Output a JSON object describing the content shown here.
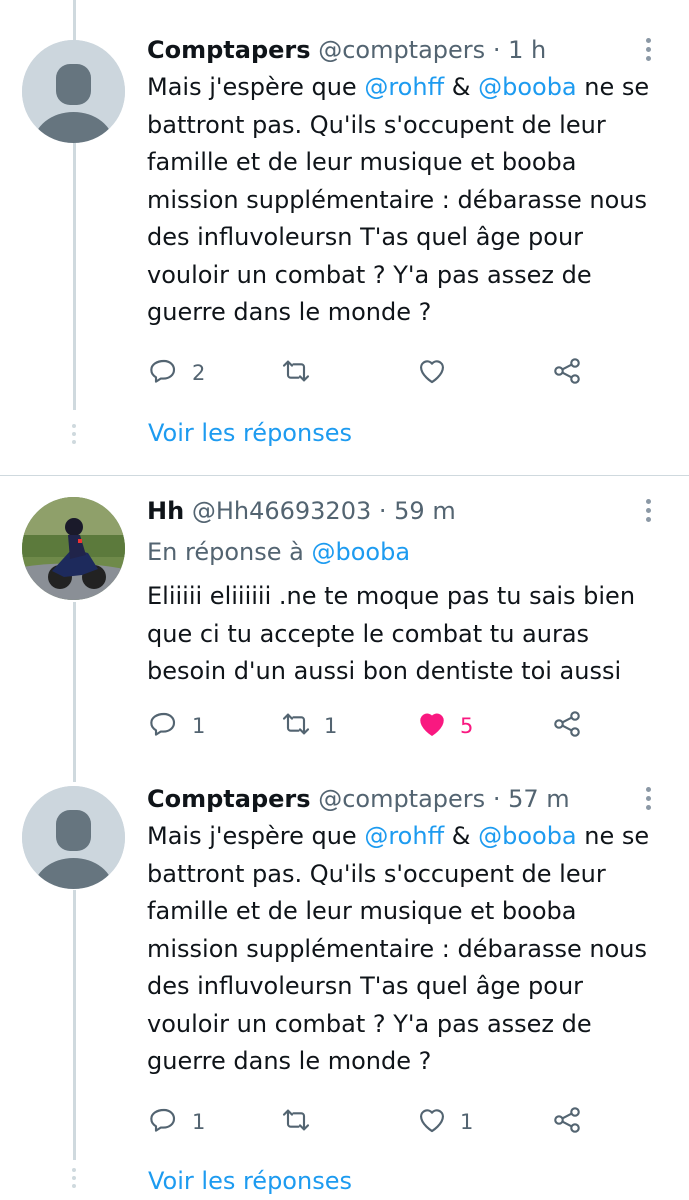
{
  "tweets": [
    {
      "author_name": "Comptapers",
      "handle": "@comptapers",
      "sep": "·",
      "time": "1 h",
      "body": [
        {
          "t": "Mais j'espère que "
        },
        {
          "t": "@rohff",
          "link": true
        },
        {
          "t": " & "
        },
        {
          "t": "@booba",
          "link": true
        },
        {
          "t": " ne se battront pas. Qu'ils s'occupent de leur famille et de leur musique et booba mission supplémentaire : débarasse nous des influvoleursn T'as quel âge pour vouloir un combat ? Y'a pas assez de guerre dans le monde ?"
        }
      ],
      "reply_icon": "reply-bubble-icon",
      "reply_count": "2",
      "retweet_icon": "retweet-icon",
      "retweet_count": "",
      "like_icon": "heart-outline-icon",
      "like_count": "",
      "share_icon": "share-icon"
    },
    {
      "author_name": "Hh",
      "handle": "@Hh46693203",
      "sep": "·",
      "time": "59 m",
      "reply_prefix": "En réponse à ",
      "reply_target": "@booba",
      "body": [
        {
          "t": "Eliiiii eliiiiii .ne te moque pas tu sais bien que ci tu accepte le combat tu auras besoin d'un aussi bon dentiste toi aussi"
        }
      ],
      "reply_icon": "reply-bubble-icon",
      "reply_count": "1",
      "retweet_icon": "retweet-icon",
      "retweet_count": "1",
      "like_icon": "heart-filled-icon",
      "like_count": "5",
      "share_icon": "share-icon"
    },
    {
      "author_name": "Comptapers",
      "handle": "@comptapers",
      "sep": "·",
      "time": "57 m",
      "body": [
        {
          "t": "Mais j'espère que "
        },
        {
          "t": "@rohff",
          "link": true
        },
        {
          "t": " & "
        },
        {
          "t": "@booba",
          "link": true
        },
        {
          "t": " ne se battront pas. Qu'ils s'occupent de leur famille et de leur musique et booba mission supplémentaire : débarasse nous des influvoleursn T'as quel âge pour vouloir un combat ? Y'a pas assez de guerre dans le monde ?"
        }
      ],
      "reply_icon": "reply-bubble-icon",
      "reply_count": "1",
      "retweet_icon": "retweet-icon",
      "retweet_count": "",
      "like_icon": "heart-outline-icon",
      "like_count": "1",
      "share_icon": "share-icon"
    }
  ],
  "show_replies_label": "Voir les réponses",
  "colors": {
    "link": "#1d9bf0",
    "muted": "#536471",
    "like_active": "#f91880",
    "thread_line": "#cfd9de",
    "avatar_placeholder": "#ccd6dd"
  }
}
